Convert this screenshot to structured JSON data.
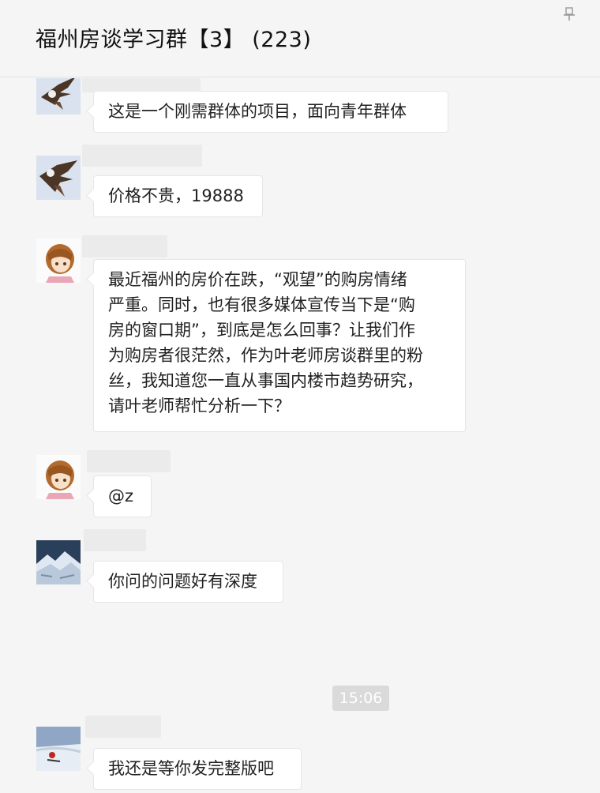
{
  "header": {
    "title": "福州房谈学习群【3】 (223)"
  },
  "icons": {
    "pin": "pin-icon"
  },
  "messages": [
    {
      "avatar": "eagle-avatar",
      "text": "这是一个刚需群体的项目，面向青年群体"
    },
    {
      "avatar": "eagle-avatar",
      "text": "价格不贵，19888"
    },
    {
      "avatar": "anime-girl-avatar",
      "lines": [
        "最近福州的房价在跌，“观望”的购房情绪",
        "严重。同时，也有很多媒体宣传当下是“购",
        "房的窗口期”，到底是怎么回事？让我们作",
        "为购房者很茫然，作为叶老师房谈群里的粉",
        "丝，我知道您一直从事国内楼市趋势研究，",
        "请叶老师帮忙分析一下？"
      ]
    },
    {
      "avatar": "anime-girl-avatar",
      "text": "@z"
    },
    {
      "avatar": "snowy-mountain-avatar",
      "text": "你问的问题好有深度"
    },
    {
      "avatar": "snow-skier-avatar",
      "text": "我还是等你发完整版吧"
    }
  ],
  "timestamp": "15:06",
  "colors": {
    "background": "#f5f5f5",
    "bubble": "#ffffff",
    "time_chip": "#dadada"
  }
}
